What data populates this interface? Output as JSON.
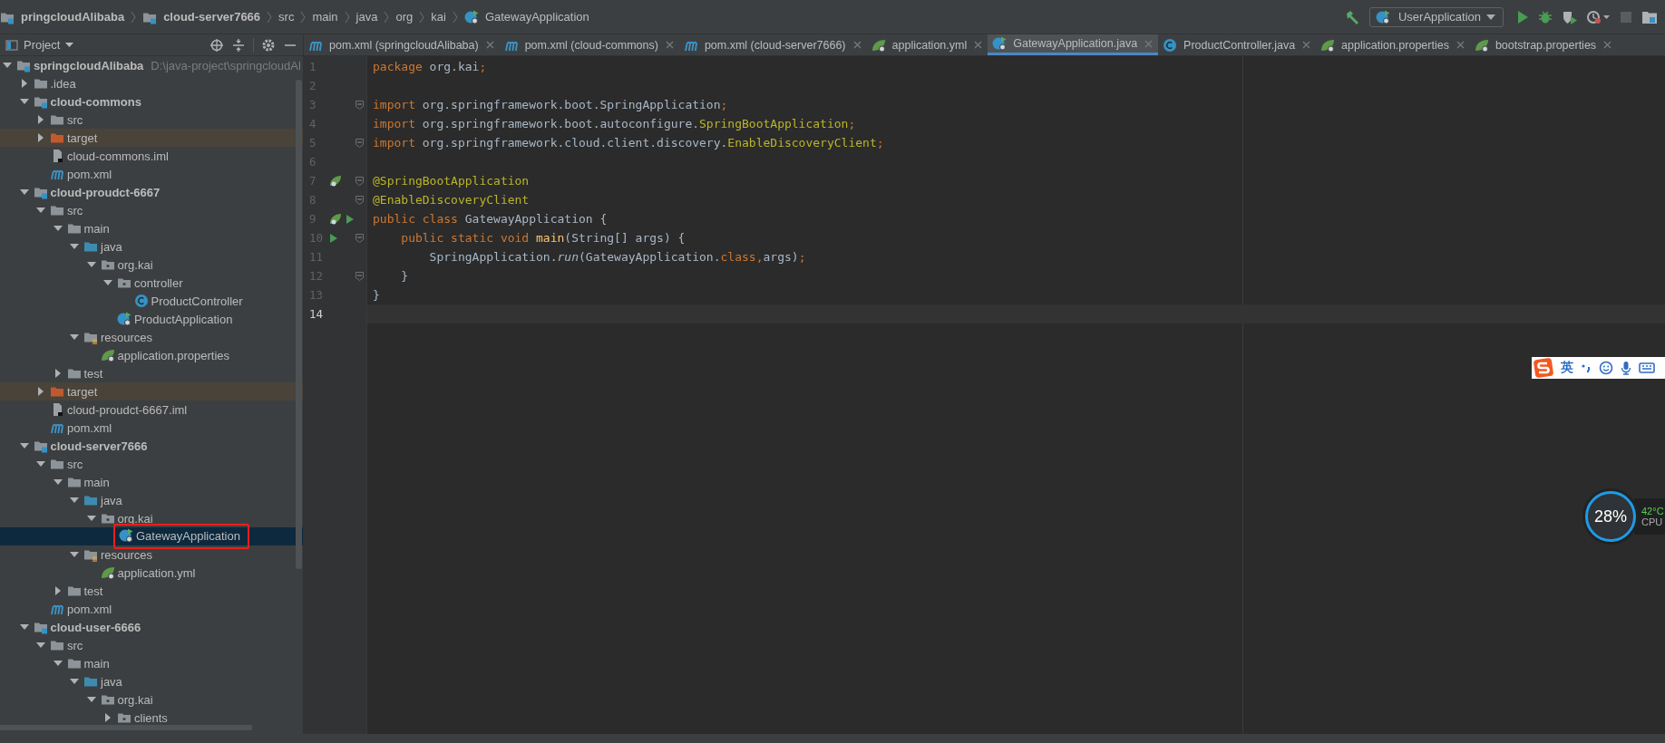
{
  "breadcrumb": [
    {
      "label": "pringcloudAlibaba",
      "kind": "module"
    },
    {
      "label": "cloud-server7666",
      "kind": "module"
    },
    {
      "label": "src",
      "kind": "dir"
    },
    {
      "label": "main",
      "kind": "dir"
    },
    {
      "label": "java",
      "kind": "dir"
    },
    {
      "label": "org",
      "kind": "dir"
    },
    {
      "label": "kai",
      "kind": "dir"
    },
    {
      "label": "GatewayApplication",
      "kind": "spring-app"
    }
  ],
  "toolbar": {
    "run_config": "UserApplication",
    "stop_disabled": true
  },
  "project_panel": {
    "title": "Project"
  },
  "tree": [
    {
      "label": "springcloudAlibaba",
      "path": "D:\\java-project\\springcloudAl",
      "kind": "module",
      "expanded": true,
      "selected": false,
      "children": [
        {
          "label": ".idea",
          "kind": "folder",
          "expanded": false,
          "selected": false
        },
        {
          "label": "cloud-commons",
          "kind": "module",
          "expanded": true,
          "selected": false,
          "children": [
            {
              "label": "src",
              "kind": "folder",
              "expanded": false,
              "selected": false
            },
            {
              "label": "target",
              "kind": "excluded",
              "expanded": false,
              "selected": false
            },
            {
              "label": "cloud-commons.iml",
              "kind": "iml",
              "selected": false
            },
            {
              "label": "pom.xml",
              "kind": "maven",
              "selected": false
            }
          ]
        },
        {
          "label": "cloud-proudct-6667",
          "kind": "module",
          "expanded": true,
          "selected": false,
          "children": [
            {
              "label": "src",
              "kind": "folder",
              "expanded": true,
              "selected": false,
              "children": [
                {
                  "label": "main",
                  "kind": "folder",
                  "expanded": true,
                  "selected": false,
                  "children": [
                    {
                      "label": "java",
                      "kind": "source",
                      "expanded": true,
                      "selected": false,
                      "children": [
                        {
                          "label": "org.kai",
                          "kind": "package",
                          "expanded": true,
                          "selected": false,
                          "children": [
                            {
                              "label": "controller",
                              "kind": "package",
                              "expanded": true,
                              "selected": false,
                              "children": [
                                {
                                  "label": "ProductController",
                                  "kind": "class",
                                  "selected": false
                                }
                              ]
                            },
                            {
                              "label": "ProductApplication",
                              "kind": "spring-app",
                              "selected": false
                            }
                          ]
                        }
                      ]
                    },
                    {
                      "label": "resources",
                      "kind": "resources",
                      "expanded": true,
                      "selected": false,
                      "children": [
                        {
                          "label": "application.properties",
                          "kind": "spring-config",
                          "selected": false
                        }
                      ]
                    }
                  ]
                },
                {
                  "label": "test",
                  "kind": "folder",
                  "expanded": false,
                  "selected": false
                }
              ]
            },
            {
              "label": "target",
              "kind": "excluded",
              "expanded": false,
              "selected": false
            },
            {
              "label": "cloud-proudct-6667.iml",
              "kind": "iml",
              "selected": false
            },
            {
              "label": "pom.xml",
              "kind": "maven",
              "selected": false
            }
          ]
        },
        {
          "label": "cloud-server7666",
          "kind": "module",
          "expanded": true,
          "selected": false,
          "children": [
            {
              "label": "src",
              "kind": "folder",
              "expanded": true,
              "selected": false,
              "children": [
                {
                  "label": "main",
                  "kind": "folder",
                  "expanded": true,
                  "selected": false,
                  "children": [
                    {
                      "label": "java",
                      "kind": "source",
                      "expanded": true,
                      "selected": false,
                      "children": [
                        {
                          "label": "org.kai",
                          "kind": "package",
                          "expanded": true,
                          "selected": false,
                          "children": [
                            {
                              "label": "GatewayApplication",
                              "kind": "spring-app",
                              "selected": true,
                              "annotated": true
                            }
                          ]
                        }
                      ]
                    },
                    {
                      "label": "resources",
                      "kind": "resources",
                      "expanded": true,
                      "selected": false,
                      "children": [
                        {
                          "label": "application.yml",
                          "kind": "spring-config",
                          "selected": false
                        }
                      ]
                    }
                  ]
                },
                {
                  "label": "test",
                  "kind": "folder",
                  "expanded": false,
                  "selected": false
                }
              ]
            },
            {
              "label": "pom.xml",
              "kind": "maven",
              "selected": false
            }
          ]
        },
        {
          "label": "cloud-user-6666",
          "kind": "module",
          "expanded": true,
          "selected": false,
          "children": [
            {
              "label": "src",
              "kind": "folder",
              "expanded": true,
              "selected": false,
              "children": [
                {
                  "label": "main",
                  "kind": "folder",
                  "expanded": true,
                  "selected": false,
                  "children": [
                    {
                      "label": "java",
                      "kind": "source",
                      "expanded": true,
                      "selected": false,
                      "children": [
                        {
                          "label": "org.kai",
                          "kind": "package",
                          "expanded": true,
                          "selected": false,
                          "children": [
                            {
                              "label": "clients",
                              "kind": "package",
                              "expanded": false,
                              "selected": false
                            }
                          ]
                        }
                      ]
                    }
                  ]
                }
              ]
            }
          ]
        }
      ]
    }
  ],
  "tabs": [
    {
      "label": "pom.xml (springcloudAlibaba)",
      "kind": "maven",
      "selected": false
    },
    {
      "label": "pom.xml (cloud-commons)",
      "kind": "maven",
      "selected": false
    },
    {
      "label": "pom.xml (cloud-server7666)",
      "kind": "maven",
      "selected": false
    },
    {
      "label": "application.yml",
      "kind": "spring-config",
      "selected": false
    },
    {
      "label": "GatewayApplication.java",
      "kind": "spring-app",
      "selected": true
    },
    {
      "label": "ProductController.java",
      "kind": "class",
      "selected": false
    },
    {
      "label": "application.properties",
      "kind": "spring-config",
      "selected": false
    },
    {
      "label": "bootstrap.properties",
      "kind": "spring-config",
      "selected": false
    }
  ],
  "editor": {
    "lines": [
      {
        "number": "1",
        "tokens": [
          {
            "t": "package",
            "kind": "kw"
          },
          {
            "t": " org.kai",
            "kind": "plain"
          },
          {
            "t": ";",
            "kind": "kw"
          }
        ],
        "current": false
      },
      {
        "number": "2",
        "current": false
      },
      {
        "number": "3",
        "fold": true,
        "tokens": [
          {
            "t": "import",
            "kind": "kw"
          },
          {
            "t": " org.springframework.boot.SpringApplication",
            "kind": "plain"
          },
          {
            "t": ";",
            "kind": "kw"
          }
        ],
        "current": false
      },
      {
        "number": "4",
        "tokens": [
          {
            "t": "import",
            "kind": "kw"
          },
          {
            "t": " org.springframework.boot.autoconfigure.",
            "kind": "plain"
          },
          {
            "t": "SpringBootApplication",
            "kind": "ann"
          },
          {
            "t": ";",
            "kind": "kw"
          }
        ],
        "current": false
      },
      {
        "number": "5",
        "fold": true,
        "tokens": [
          {
            "t": "import",
            "kind": "kw"
          },
          {
            "t": " org.springframework.cloud.client.discovery.",
            "kind": "plain"
          },
          {
            "t": "EnableDiscoveryClient",
            "kind": "ann"
          },
          {
            "t": ";",
            "kind": "kw"
          }
        ],
        "current": false
      },
      {
        "number": "6",
        "current": false
      },
      {
        "number": "7",
        "fold": true,
        "gutter": [
          {
            "kind": "spring"
          }
        ],
        "tokens": [
          {
            "t": "@SpringBootApplication",
            "kind": "ann"
          }
        ],
        "current": false
      },
      {
        "number": "8",
        "fold": true,
        "tokens": [
          {
            "t": "@EnableDiscoveryClient",
            "kind": "ann"
          }
        ],
        "current": false
      },
      {
        "number": "9",
        "gutter": [
          {
            "kind": "spring"
          },
          {
            "kind": "run"
          }
        ],
        "tokens": [
          {
            "t": "public class",
            "kind": "kw"
          },
          {
            "t": " GatewayApplication {",
            "kind": "plain"
          }
        ],
        "current": false
      },
      {
        "number": "10",
        "fold": true,
        "gutter": [
          {
            "kind": "run"
          }
        ],
        "tokens": [
          {
            "t": "    public static void ",
            "kind": "kw"
          },
          {
            "t": "main",
            "kind": "fn"
          },
          {
            "t": "(String[] args) {",
            "kind": "plain"
          }
        ],
        "current": false
      },
      {
        "number": "11",
        "tokens": [
          {
            "t": "        SpringApplication.",
            "kind": "plain"
          },
          {
            "t": "run",
            "kind": "it"
          },
          {
            "t": "(GatewayApplication.",
            "kind": "plain"
          },
          {
            "t": "class",
            "kind": "kw"
          },
          {
            "t": ",",
            "kind": "kw"
          },
          {
            "t": "args)",
            "kind": "plain"
          },
          {
            "t": ";",
            "kind": "kw"
          }
        ],
        "current": false
      },
      {
        "number": "12",
        "fold": true,
        "tokens": [
          {
            "t": "    }",
            "kind": "plain"
          }
        ],
        "current": false
      },
      {
        "number": "13",
        "tokens": [
          {
            "t": "}",
            "kind": "plain"
          }
        ],
        "current": false
      },
      {
        "number": "14",
        "current": true
      }
    ]
  },
  "ime_bar": {
    "mode": "英"
  },
  "cpu_monitor": {
    "usage": "28%",
    "temperature": "42°C",
    "label": "CPU"
  }
}
